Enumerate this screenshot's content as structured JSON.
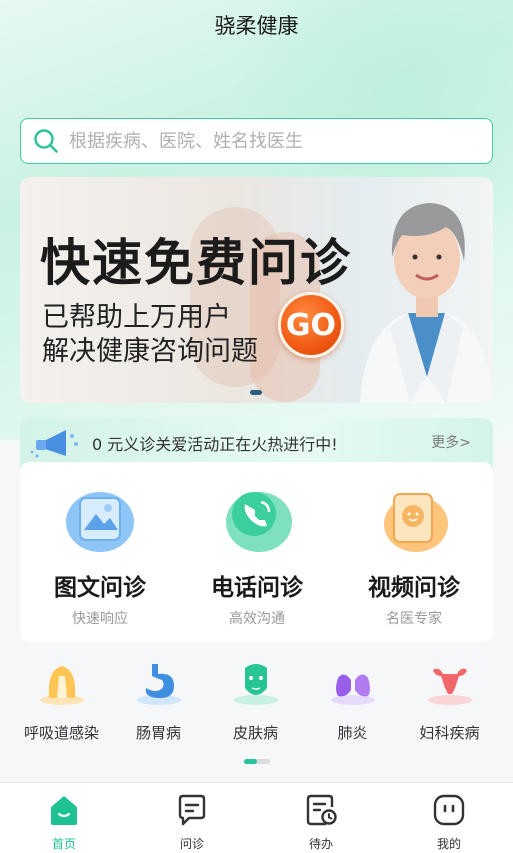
{
  "app": {
    "title": "骁柔健康"
  },
  "search": {
    "placeholder": "根据疾病、医院、姓名找医生"
  },
  "banner": {
    "headline": "快速免费问诊",
    "line1": "已帮助上万用户",
    "line2": "解决健康咨询问题",
    "go_label": "GO"
  },
  "notice": {
    "text": "0 元义诊关爱活动正在火热进行中!",
    "more": "更多>"
  },
  "consult": [
    {
      "name": "图文问诊",
      "desc": "快速响应",
      "icon": "image-consult-icon"
    },
    {
      "name": "电话问诊",
      "desc": "高效沟通",
      "icon": "phone-consult-icon"
    },
    {
      "name": "视频问诊",
      "desc": "名医专家",
      "icon": "video-consult-icon"
    }
  ],
  "departments": [
    {
      "label": "呼吸道感染",
      "icon": "throat-icon"
    },
    {
      "label": "肠胃病",
      "icon": "stomach-icon"
    },
    {
      "label": "皮肤病",
      "icon": "face-mask-icon"
    },
    {
      "label": "肺炎",
      "icon": "lungs-icon"
    },
    {
      "label": "妇科疾病",
      "icon": "uterus-icon"
    }
  ],
  "tabs": [
    {
      "label": "首页",
      "icon": "home-icon",
      "active": true
    },
    {
      "label": "问诊",
      "icon": "chat-icon",
      "active": false
    },
    {
      "label": "待办",
      "icon": "todo-icon",
      "active": false
    },
    {
      "label": "我的",
      "icon": "profile-icon",
      "active": false
    }
  ],
  "colors": {
    "accent": "#1fc294",
    "go": "#f05a14"
  }
}
